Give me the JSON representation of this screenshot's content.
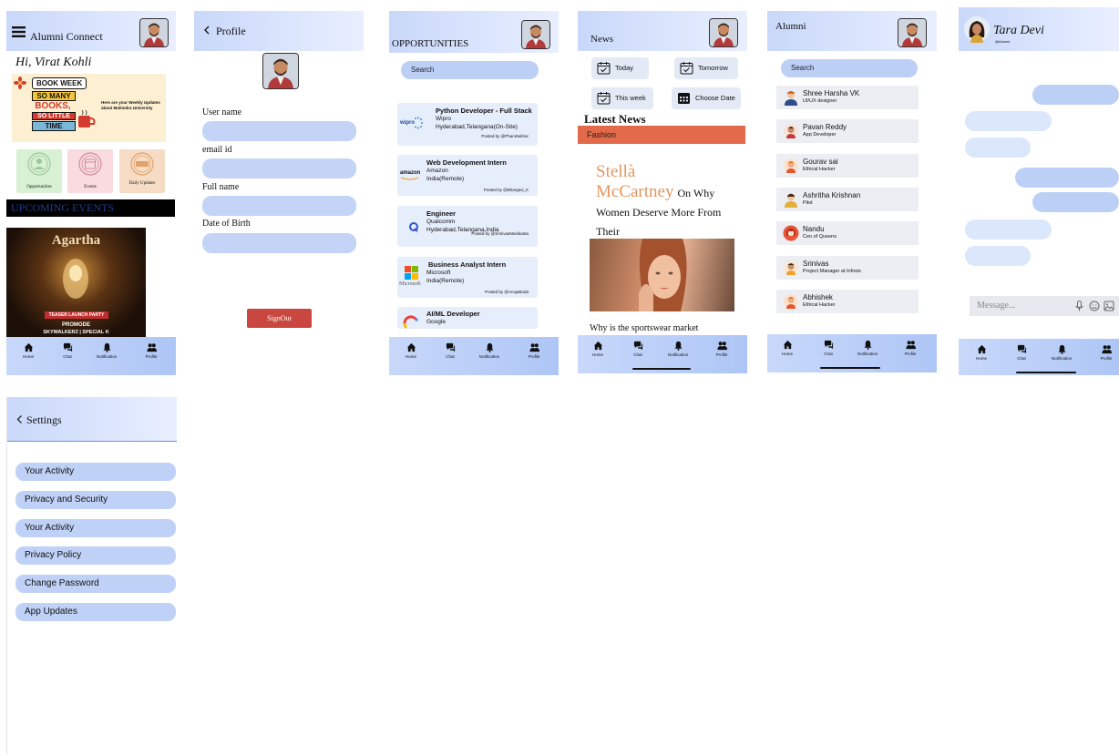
{
  "home": {
    "title": "Alumni Connect",
    "greeting": "Hi, Virat Kohli",
    "banner": {
      "badge": "BOOK WEEK",
      "line1": "SO MANY",
      "line2": "BOOKS,",
      "line3": "SO LITTLE",
      "line4": "TIME",
      "subtext": "Here are your Weekly Updates about Mahindra University"
    },
    "tiles": [
      {
        "label": "Opportunities"
      },
      {
        "label": "Events"
      },
      {
        "label": "Daily Updates"
      }
    ],
    "section_title": "UPCOMING EVENTS",
    "poster": {
      "title": "Agartha",
      "sub1": "TEASER LAUNCH PARTY",
      "sub2": "PROMODE",
      "sub3": "SKYWALKERZ | SPECIAL K"
    }
  },
  "profile": {
    "title": "Profile",
    "fields": [
      {
        "label": "User name"
      },
      {
        "label": "email id"
      },
      {
        "label": "Full name"
      },
      {
        "label": "Date of Birth"
      }
    ],
    "signout_label": "SignOut"
  },
  "opportunities": {
    "title": "OPPORTUNITIES",
    "search_placeholder": "Search",
    "jobs": [
      {
        "title": "Python Developer - Full Stack",
        "company": "Wipro",
        "location": "Hyderabad,Telangana(On-Site)",
        "posted": "Posted by @PhaniSekhar",
        "logo": "wipro"
      },
      {
        "title": "Web Development Intern",
        "company": "Amazon",
        "location": "India(Remote)",
        "posted": "Posted by @Bhargavi_K",
        "logo": "amazon"
      },
      {
        "title": "Engineer",
        "company": "Qualcomm",
        "location": "Hyderabad,Telangana,India",
        "posted": "Posted by @SrinivasManikanta",
        "logo": ""
      },
      {
        "title": "Business Analyst Intern",
        "company": "Microsoft",
        "location": "India(Remote)",
        "posted": "Posted by @AnujaBoda",
        "logo": "Microsoft"
      },
      {
        "title": "AI/ML Developer",
        "company": "Google",
        "location": "",
        "posted": "",
        "logo": ""
      }
    ]
  },
  "news": {
    "title": "News",
    "filters": [
      {
        "label": "Today"
      },
      {
        "label": "Tomorrow"
      },
      {
        "label": "This week"
      },
      {
        "label": "Choose Date"
      }
    ],
    "section_title": "Latest News",
    "category": "Fashion",
    "headline_part1": "Stellà",
    "headline_part2": "McCartney",
    "headline_part3": "On Why Women Deserve More From Their",
    "teaser": "Why is the sportswear market"
  },
  "alumni": {
    "title": "Alumni",
    "search_placeholder": "Search",
    "people": [
      {
        "name": "Shree Harsha VK",
        "role": "UI/UX designer"
      },
      {
        "name": "Pavan Reddy",
        "role": "App Developer"
      },
      {
        "name": "Gourav sai",
        "role": "Ethical Hacker"
      },
      {
        "name": "Ashritha Krishnan",
        "role": "Pilot"
      },
      {
        "name": "Nandu",
        "role": "Ceo of Queens"
      },
      {
        "name": "Srinivas",
        "role": "Project Manager at Infosis"
      },
      {
        "name": "Abhishek",
        "role": "Ethical Hacker"
      }
    ]
  },
  "chat": {
    "contact_name": "Tara Devi",
    "contact_handle": "@Alumni",
    "message_placeholder": "Message..."
  },
  "settings": {
    "title": "Settings",
    "items": [
      {
        "label": "Your Activity"
      },
      {
        "label": "Privacy and Security"
      },
      {
        "label": "Your Activity"
      },
      {
        "label": "Privacy Policy"
      },
      {
        "label": "Change Password"
      },
      {
        "label": "App Updates"
      }
    ]
  },
  "nav": {
    "home": "Home",
    "chat": "Chat",
    "notification": "Notification",
    "profile": "Profile"
  },
  "colors": {
    "accent": "#c3d3f7",
    "header_gradient_start": "#c9d8fa",
    "fashion_bar": "#e26a4a",
    "signout": "#c9473e",
    "headline_orange": "#e2955d"
  }
}
